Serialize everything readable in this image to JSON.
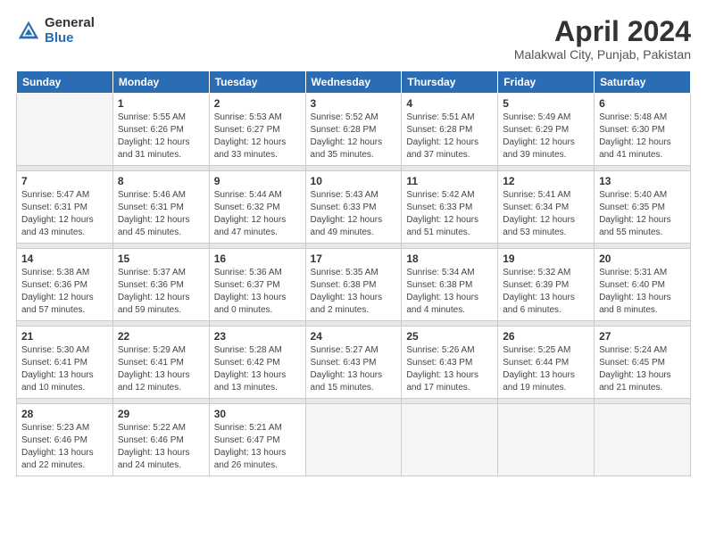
{
  "logo": {
    "general": "General",
    "blue": "Blue"
  },
  "header": {
    "title": "April 2024",
    "subtitle": "Malakwal City, Punjab, Pakistan"
  },
  "columns": [
    "Sunday",
    "Monday",
    "Tuesday",
    "Wednesday",
    "Thursday",
    "Friday",
    "Saturday"
  ],
  "weeks": [
    [
      {
        "day": "",
        "sunrise": "",
        "sunset": "",
        "daylight": ""
      },
      {
        "day": "1",
        "sunrise": "Sunrise: 5:55 AM",
        "sunset": "Sunset: 6:26 PM",
        "daylight": "Daylight: 12 hours and 31 minutes."
      },
      {
        "day": "2",
        "sunrise": "Sunrise: 5:53 AM",
        "sunset": "Sunset: 6:27 PM",
        "daylight": "Daylight: 12 hours and 33 minutes."
      },
      {
        "day": "3",
        "sunrise": "Sunrise: 5:52 AM",
        "sunset": "Sunset: 6:28 PM",
        "daylight": "Daylight: 12 hours and 35 minutes."
      },
      {
        "day": "4",
        "sunrise": "Sunrise: 5:51 AM",
        "sunset": "Sunset: 6:28 PM",
        "daylight": "Daylight: 12 hours and 37 minutes."
      },
      {
        "day": "5",
        "sunrise": "Sunrise: 5:49 AM",
        "sunset": "Sunset: 6:29 PM",
        "daylight": "Daylight: 12 hours and 39 minutes."
      },
      {
        "day": "6",
        "sunrise": "Sunrise: 5:48 AM",
        "sunset": "Sunset: 6:30 PM",
        "daylight": "Daylight: 12 hours and 41 minutes."
      }
    ],
    [
      {
        "day": "7",
        "sunrise": "Sunrise: 5:47 AM",
        "sunset": "Sunset: 6:31 PM",
        "daylight": "Daylight: 12 hours and 43 minutes."
      },
      {
        "day": "8",
        "sunrise": "Sunrise: 5:46 AM",
        "sunset": "Sunset: 6:31 PM",
        "daylight": "Daylight: 12 hours and 45 minutes."
      },
      {
        "day": "9",
        "sunrise": "Sunrise: 5:44 AM",
        "sunset": "Sunset: 6:32 PM",
        "daylight": "Daylight: 12 hours and 47 minutes."
      },
      {
        "day": "10",
        "sunrise": "Sunrise: 5:43 AM",
        "sunset": "Sunset: 6:33 PM",
        "daylight": "Daylight: 12 hours and 49 minutes."
      },
      {
        "day": "11",
        "sunrise": "Sunrise: 5:42 AM",
        "sunset": "Sunset: 6:33 PM",
        "daylight": "Daylight: 12 hours and 51 minutes."
      },
      {
        "day": "12",
        "sunrise": "Sunrise: 5:41 AM",
        "sunset": "Sunset: 6:34 PM",
        "daylight": "Daylight: 12 hours and 53 minutes."
      },
      {
        "day": "13",
        "sunrise": "Sunrise: 5:40 AM",
        "sunset": "Sunset: 6:35 PM",
        "daylight": "Daylight: 12 hours and 55 minutes."
      }
    ],
    [
      {
        "day": "14",
        "sunrise": "Sunrise: 5:38 AM",
        "sunset": "Sunset: 6:36 PM",
        "daylight": "Daylight: 12 hours and 57 minutes."
      },
      {
        "day": "15",
        "sunrise": "Sunrise: 5:37 AM",
        "sunset": "Sunset: 6:36 PM",
        "daylight": "Daylight: 12 hours and 59 minutes."
      },
      {
        "day": "16",
        "sunrise": "Sunrise: 5:36 AM",
        "sunset": "Sunset: 6:37 PM",
        "daylight": "Daylight: 13 hours and 0 minutes."
      },
      {
        "day": "17",
        "sunrise": "Sunrise: 5:35 AM",
        "sunset": "Sunset: 6:38 PM",
        "daylight": "Daylight: 13 hours and 2 minutes."
      },
      {
        "day": "18",
        "sunrise": "Sunrise: 5:34 AM",
        "sunset": "Sunset: 6:38 PM",
        "daylight": "Daylight: 13 hours and 4 minutes."
      },
      {
        "day": "19",
        "sunrise": "Sunrise: 5:32 AM",
        "sunset": "Sunset: 6:39 PM",
        "daylight": "Daylight: 13 hours and 6 minutes."
      },
      {
        "day": "20",
        "sunrise": "Sunrise: 5:31 AM",
        "sunset": "Sunset: 6:40 PM",
        "daylight": "Daylight: 13 hours and 8 minutes."
      }
    ],
    [
      {
        "day": "21",
        "sunrise": "Sunrise: 5:30 AM",
        "sunset": "Sunset: 6:41 PM",
        "daylight": "Daylight: 13 hours and 10 minutes."
      },
      {
        "day": "22",
        "sunrise": "Sunrise: 5:29 AM",
        "sunset": "Sunset: 6:41 PM",
        "daylight": "Daylight: 13 hours and 12 minutes."
      },
      {
        "day": "23",
        "sunrise": "Sunrise: 5:28 AM",
        "sunset": "Sunset: 6:42 PM",
        "daylight": "Daylight: 13 hours and 13 minutes."
      },
      {
        "day": "24",
        "sunrise": "Sunrise: 5:27 AM",
        "sunset": "Sunset: 6:43 PM",
        "daylight": "Daylight: 13 hours and 15 minutes."
      },
      {
        "day": "25",
        "sunrise": "Sunrise: 5:26 AM",
        "sunset": "Sunset: 6:43 PM",
        "daylight": "Daylight: 13 hours and 17 minutes."
      },
      {
        "day": "26",
        "sunrise": "Sunrise: 5:25 AM",
        "sunset": "Sunset: 6:44 PM",
        "daylight": "Daylight: 13 hours and 19 minutes."
      },
      {
        "day": "27",
        "sunrise": "Sunrise: 5:24 AM",
        "sunset": "Sunset: 6:45 PM",
        "daylight": "Daylight: 13 hours and 21 minutes."
      }
    ],
    [
      {
        "day": "28",
        "sunrise": "Sunrise: 5:23 AM",
        "sunset": "Sunset: 6:46 PM",
        "daylight": "Daylight: 13 hours and 22 minutes."
      },
      {
        "day": "29",
        "sunrise": "Sunrise: 5:22 AM",
        "sunset": "Sunset: 6:46 PM",
        "daylight": "Daylight: 13 hours and 24 minutes."
      },
      {
        "day": "30",
        "sunrise": "Sunrise: 5:21 AM",
        "sunset": "Sunset: 6:47 PM",
        "daylight": "Daylight: 13 hours and 26 minutes."
      },
      {
        "day": "",
        "sunrise": "",
        "sunset": "",
        "daylight": ""
      },
      {
        "day": "",
        "sunrise": "",
        "sunset": "",
        "daylight": ""
      },
      {
        "day": "",
        "sunrise": "",
        "sunset": "",
        "daylight": ""
      },
      {
        "day": "",
        "sunrise": "",
        "sunset": "",
        "daylight": ""
      }
    ]
  ]
}
